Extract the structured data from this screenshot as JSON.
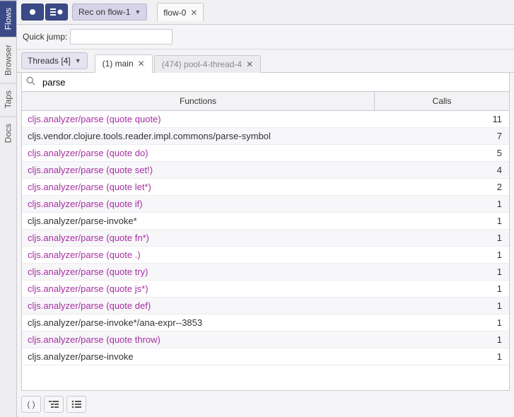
{
  "sidebar": {
    "tabs": [
      {
        "label": "Flows",
        "active": true
      },
      {
        "label": "Browser",
        "active": false
      },
      {
        "label": "Taps",
        "active": false
      },
      {
        "label": "Docs",
        "active": false
      }
    ]
  },
  "toolbar": {
    "rec_label": "Rec on flow-1",
    "flow_tab": "flow-0"
  },
  "quickjump": {
    "label": "Quick jump:"
  },
  "threads": {
    "label": "Threads [4]",
    "tabs": [
      {
        "label": "(1) main",
        "active": true
      },
      {
        "label": "(474) pool-4-thread-4",
        "active": false
      }
    ]
  },
  "search": {
    "value": "parse"
  },
  "table": {
    "headers": {
      "functions": "Functions",
      "calls": "Calls"
    },
    "rows": [
      {
        "fn": "cljs.analyzer/parse (quote quote)",
        "calls": 11,
        "hl": true
      },
      {
        "fn": "cljs.vendor.clojure.tools.reader.impl.commons/parse-symbol",
        "calls": 7,
        "hl": false
      },
      {
        "fn": "cljs.analyzer/parse (quote do)",
        "calls": 5,
        "hl": true
      },
      {
        "fn": "cljs.analyzer/parse (quote set!)",
        "calls": 4,
        "hl": true
      },
      {
        "fn": "cljs.analyzer/parse (quote let*)",
        "calls": 2,
        "hl": true
      },
      {
        "fn": "cljs.analyzer/parse (quote if)",
        "calls": 1,
        "hl": true
      },
      {
        "fn": "cljs.analyzer/parse-invoke*",
        "calls": 1,
        "hl": false
      },
      {
        "fn": "cljs.analyzer/parse (quote fn*)",
        "calls": 1,
        "hl": true
      },
      {
        "fn": "cljs.analyzer/parse (quote .)",
        "calls": 1,
        "hl": true
      },
      {
        "fn": "cljs.analyzer/parse (quote try)",
        "calls": 1,
        "hl": true
      },
      {
        "fn": "cljs.analyzer/parse (quote js*)",
        "calls": 1,
        "hl": true
      },
      {
        "fn": "cljs.analyzer/parse (quote def)",
        "calls": 1,
        "hl": true
      },
      {
        "fn": "cljs.analyzer/parse-invoke*/ana-expr--3853",
        "calls": 1,
        "hl": false
      },
      {
        "fn": "cljs.analyzer/parse (quote throw)",
        "calls": 1,
        "hl": true
      },
      {
        "fn": "cljs.analyzer/parse-invoke",
        "calls": 1,
        "hl": false
      }
    ]
  },
  "bottom_tools": {
    "paren": "( )"
  }
}
